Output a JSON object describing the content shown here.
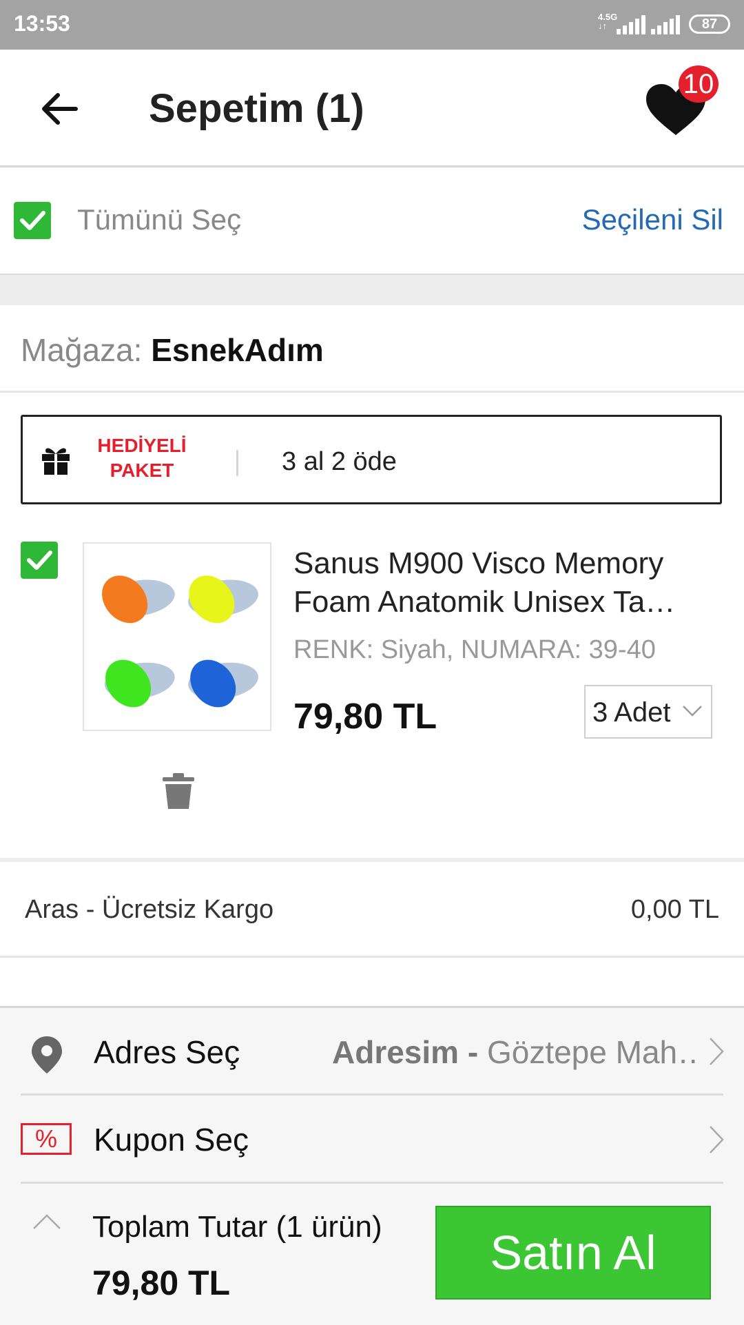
{
  "status_bar": {
    "time": "13:53",
    "network": "4.5G",
    "battery": "87"
  },
  "header": {
    "title": "Sepetim (1)",
    "wishlist_badge": "10"
  },
  "select_bar": {
    "select_all_label": "Tümünü Seç",
    "delete_selected_label": "Seçileni Sil"
  },
  "store": {
    "prefix": "Mağaza:",
    "name": "EsnekAdım"
  },
  "campaign": {
    "tag_line1": "HEDİYELİ",
    "tag_line2": "PAKET",
    "text": "3 al 2 öde"
  },
  "product": {
    "name": "Sanus M900  Visco Memory Foam Anatomik Unisex Ta…",
    "attributes": "RENK: Siyah, NUMARA: 39-40",
    "price": "79,80 TL",
    "quantity": "3 Adet",
    "image_colors": [
      "#f47a20",
      "#e8f51a",
      "#3fe620",
      "#1f63d8"
    ]
  },
  "shipping": {
    "name": "Aras - Ücretsiz Kargo",
    "price": "0,00 TL"
  },
  "address": {
    "label": "Adres Seç",
    "value_bold": "Adresim -",
    "value": "Göztepe Mah…"
  },
  "coupon": {
    "label": "Kupon Seç",
    "icon_text": "%"
  },
  "total": {
    "label": "Toplam Tutar",
    "count": "(1 ürün)",
    "price": "79,80 TL"
  },
  "buy_button": {
    "label": "Satın Al"
  },
  "colors": {
    "accent_green": "#3dc634",
    "badge_red": "#e3202c",
    "link_blue": "#2469b3"
  }
}
